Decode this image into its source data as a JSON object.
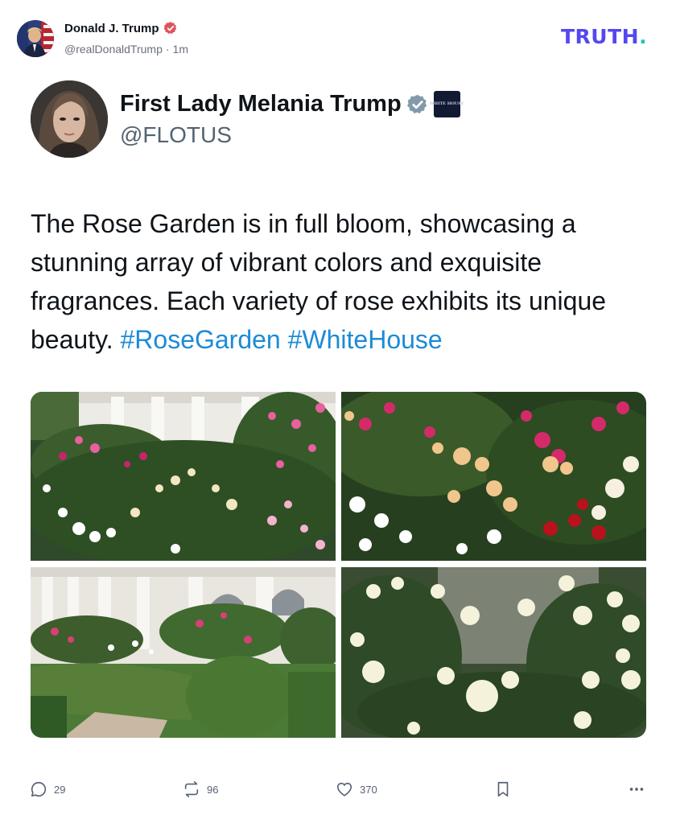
{
  "author": {
    "name": "Donald J. Trump",
    "handle": "@realDonaldTrump",
    "separator": "·",
    "time": "1m"
  },
  "brand": {
    "logo_text": "TRUTH",
    "logo_dot": ".",
    "primary_color": "#5448ee",
    "dot_color": "#19c9b6"
  },
  "quoted": {
    "name": "First Lady Melania Trump",
    "handle": "@FLOTUS",
    "affiliation_badge": "WHITE HOUSE",
    "text": "The Rose Garden is in full bloom, showcasing a stunning array of vibrant colors and exquisite fragrances. Each variety of rose exhibits its unique beauty.",
    "hashtags": [
      "#RoseGarden",
      "#WhiteHouse"
    ],
    "hashtag_color": "#1d8bd6",
    "images": [
      {
        "icon": "rose-garden-colonnade-photo"
      },
      {
        "icon": "pink-red-yellow-roses-photo"
      },
      {
        "icon": "colonnade-hedges-photo"
      },
      {
        "icon": "white-roses-photo"
      }
    ]
  },
  "actions": {
    "replies": "29",
    "retruths": "96",
    "likes": "370"
  }
}
